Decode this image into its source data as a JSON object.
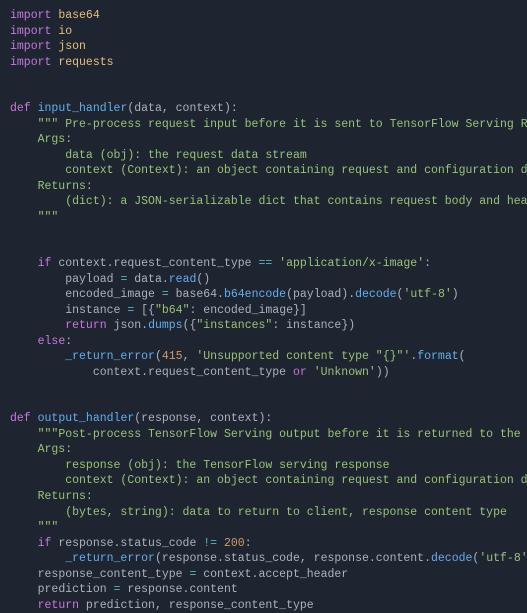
{
  "imports": {
    "kw": "import",
    "m1": "base64",
    "m2": "io",
    "m3": "json",
    "m4": "requests"
  },
  "fn1": {
    "def": "def",
    "name": "input_handler",
    "params": "(data, context):",
    "doc1": "\"\"\" Pre-process request input before it is sent to TensorFlow Serving REST API",
    "doc2": "",
    "doc3": "    Args:",
    "doc4": "        data (obj): the request data stream",
    "doc5": "        context (Context): an object containing request and configuration details",
    "doc6": "",
    "doc7": "    Returns:",
    "doc8": "        (dict): a JSON-serializable dict that contains request body and headers",
    "doc9": "    \"\"\"",
    "if_kw": "if",
    "if_cond1": "context.request_content_type ",
    "if_op": "==",
    "if_str": " 'application/x-image'",
    "if_colon": ":",
    "l1a": "payload ",
    "l1b": "=",
    "l1c": " data.",
    "l1d": "read",
    "l1e": "()",
    "l2a": "encoded_image ",
    "l2b": "=",
    "l2c": " base64.",
    "l2d": "b64encode",
    "l2e": "(payload).",
    "l2f": "decode",
    "l2g": "(",
    "l2h": "'utf-8'",
    "l2i": ")",
    "l3a": "instance ",
    "l3b": "=",
    "l3c": " [{",
    "l3d": "\"b64\"",
    "l3e": ": encoded_image}]",
    "ret_kw": "return",
    "ret1a": " json.",
    "ret1b": "dumps",
    "ret1c": "({",
    "ret1d": "\"instances\"",
    "ret1e": ": instance})",
    "else_kw": "else",
    "else_colon": ":",
    "err1a": "_return_error",
    "err1b": "(",
    "err1c": "415",
    "err1d": ", ",
    "err1e": "'Unsupported content type \"{}\"'",
    "err1f": ".",
    "err1g": "format",
    "err1h": "(",
    "err2a": "context.request_content_type ",
    "err2b": "or",
    "err2c": " ",
    "err2d": "'Unknown'",
    "err2e": "))"
  },
  "fn2": {
    "def": "def",
    "name": "output_handler",
    "params": "(response, context):",
    "doc1": "\"\"\"Post-process TensorFlow Serving output before it is returned to the client.",
    "doc2": "",
    "doc3": "    Args:",
    "doc4": "        response (obj): the TensorFlow serving response",
    "doc5": "        context (Context): an object containing request and configuration details",
    "doc6": "",
    "doc7": "    Returns:",
    "doc8": "        (bytes, string): data to return to client, response content type",
    "doc9": "    \"\"\"",
    "if_kw": "if",
    "if_a": " response.status_code ",
    "if_op": "!=",
    "if_b": " ",
    "if_num": "200",
    "if_colon": ":",
    "e1a": "_return_error",
    "e1b": "(response.status_code, response.content.",
    "e1c": "decode",
    "e1d": "(",
    "e1e": "'utf-8'",
    "e1f": "))",
    "l1a": "response_content_type ",
    "l1b": "=",
    "l1c": " context.accept_header",
    "l2a": "prediction ",
    "l2b": "=",
    "l2c": " response.content",
    "ret_kw": "return",
    "ret_a": " prediction, response_content_type"
  }
}
